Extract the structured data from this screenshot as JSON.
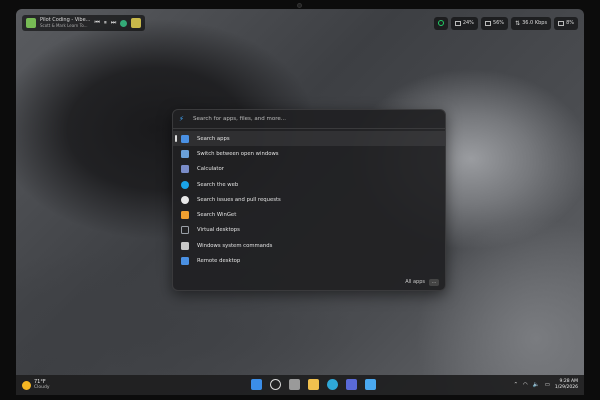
{
  "media": {
    "title": "Pilot Coding - Vibe...",
    "artist": "Scott & Mark Learn To..."
  },
  "status": {
    "cpu": "24%",
    "memory": "56%",
    "network": "36.0 Kbps",
    "battery": "8%"
  },
  "run": {
    "placeholder": "Search for apps, files, and more...",
    "items": [
      {
        "label": "Search apps",
        "icon": "apps-search-icon",
        "color": "#4a90e2"
      },
      {
        "label": "Switch between open windows",
        "icon": "window-switch-icon",
        "color": "#6aa0d8"
      },
      {
        "label": "Calculator",
        "icon": "calculator-icon",
        "color": "#7a8cc8"
      },
      {
        "label": "Search the web",
        "icon": "web-search-icon",
        "color": "#1aa3e8"
      },
      {
        "label": "Search issues and pull requests",
        "icon": "github-icon",
        "color": "#e8e8e8"
      },
      {
        "label": "Search WinGet",
        "icon": "winget-icon",
        "color": "#f0a030"
      },
      {
        "label": "Virtual desktops",
        "icon": "virtual-desktops-icon",
        "color": "#9aa0a8"
      },
      {
        "label": "Windows system commands",
        "icon": "system-commands-icon",
        "color": "#c8c8c8"
      },
      {
        "label": "Remote desktop",
        "icon": "remote-desktop-icon",
        "color": "#4a90e2"
      }
    ],
    "footer_label": "All apps"
  },
  "taskbar": {
    "temp": "71°F",
    "condition": "Cloudy",
    "apps": [
      {
        "name": "start-icon",
        "color": "#3b8ee8"
      },
      {
        "name": "search-icon",
        "color": "#d8d8d8"
      },
      {
        "name": "task-view-icon",
        "color": "#9a9a9a"
      },
      {
        "name": "file-explorer-icon",
        "color": "#f2c14e"
      },
      {
        "name": "edge-icon",
        "color": "#2fa8d8"
      },
      {
        "name": "store-icon",
        "color": "#5a6ad8"
      },
      {
        "name": "powertoys-run-icon",
        "color": "#4aa8f0"
      }
    ],
    "time": "9:28 AM",
    "date": "1/29/2026"
  }
}
